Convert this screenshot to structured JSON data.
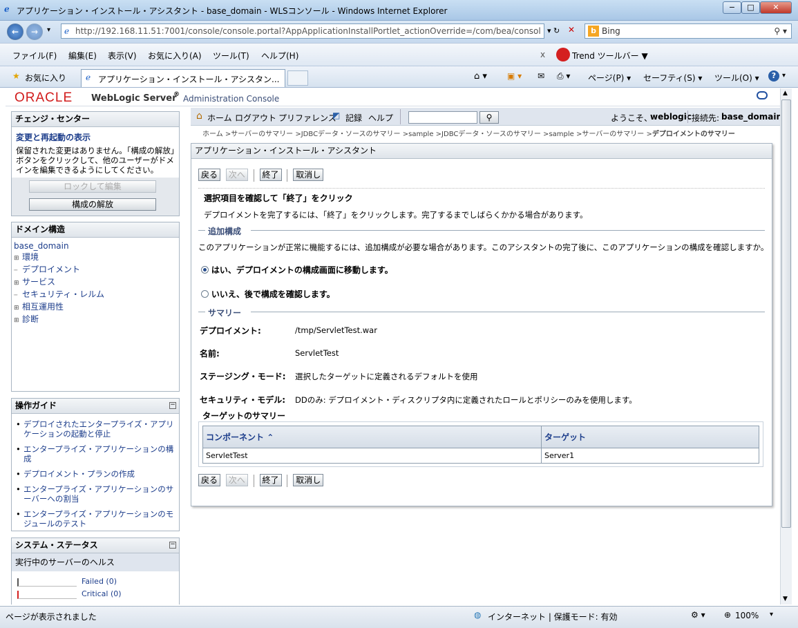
{
  "window": {
    "title": "アプリケーション・インストール・アシスタント - base_domain - WLSコンソール - Windows Internet Explorer",
    "minimize": "−",
    "maximize": "□",
    "close": "✕"
  },
  "browser": {
    "address_host": "http://192.168.11.51",
    "address_rest": ":7001/console/console.portal?AppApplicationInstallPortlet_actionOverride=/com/bea/consol",
    "search_engine": "Bing",
    "menu": [
      "ファイル(F)",
      "編集(E)",
      "表示(V)",
      "お気に入り(A)",
      "ツール(T)",
      "ヘルプ(H)"
    ],
    "trend_toolbar": "Trend ツールバー ▼",
    "favorites": "お気に入り",
    "tab_title": "アプリケーション・インストール・アシスタン...",
    "cmd_page": "ページ(P) ▾",
    "cmd_safety": "セーフティ(S) ▾",
    "cmd_tools": "ツール(O) ▾",
    "status_text": "ページが表示されました",
    "zone": "インターネット | 保護モード: 有効",
    "zoom": "100%"
  },
  "header": {
    "oracle": "ORACLE",
    "product": "WebLogic Server",
    "reg": "®",
    "console": "Administration Console"
  },
  "toolbar": {
    "home": "ホーム",
    "logout": "ログアウト",
    "preferences": "プリファレンス",
    "record": "記録",
    "help": "ヘルプ",
    "search_value": "",
    "welcome": "ようこそ、",
    "user": "weblogic",
    "connected": "接続先:",
    "domain": "base_domain"
  },
  "breadcrumb": {
    "items": [
      "ホーム",
      "サーバーのサマリー",
      "JDBCデータ・ソースのサマリー",
      "sample",
      "JDBCデータ・ソースのサマリー",
      "sample",
      "サーバーのサマリー"
    ],
    "current": "デプロイメントのサマリー"
  },
  "change_center": {
    "title": "チェンジ・センター",
    "link": "変更と再起動の表示",
    "message": "保留された変更はありません。「構成の解放」ボタンをクリックして、他のユーザーがドメインを編集できるようにしてください。",
    "lock_button": "ロックして編集",
    "release_button": "構成の解放"
  },
  "domain_structure": {
    "title": "ドメイン構造",
    "root": "base_domain",
    "items": [
      {
        "label": "環境",
        "expand": "+"
      },
      {
        "label": "デプロイメント",
        "expand": ""
      },
      {
        "label": "サービス",
        "expand": "+"
      },
      {
        "label": "セキュリティ・レルム",
        "expand": ""
      },
      {
        "label": "相互運用性",
        "expand": "+"
      },
      {
        "label": "診断",
        "expand": "+"
      }
    ]
  },
  "how_do_i": {
    "title": "操作ガイド",
    "items": [
      "デプロイされたエンタープライズ・アプリケーションの起動と停止",
      "エンタープライズ・アプリケーションの構成",
      "デプロイメント・プランの作成",
      "エンタープライズ・アプリケーションのサーバーへの割当",
      "エンタープライズ・アプリケーションのモジュールのテスト"
    ]
  },
  "system_status": {
    "title": "システム・ステータス",
    "subtitle": "実行中のサーバーのヘルス",
    "rows": [
      {
        "label": "Failed (0)",
        "color": "#555555",
        "value": 0
      },
      {
        "label": "Critical (0)",
        "color": "#d42020",
        "value": 0
      }
    ]
  },
  "assistant": {
    "title": "アプリケーション・インストール・アシスタント",
    "buttons": {
      "back": "戻る",
      "next": "次へ",
      "finish": "終了",
      "cancel": "取消し"
    },
    "heading": "選択項目を確認して「終了」をクリック",
    "instruction": "デプロイメントを完了するには、「終了」をクリックします。完了するまでしばらくかかる場合があります。",
    "additional_title": "追加構成",
    "additional_text": "このアプリケーションが正常に機能するには、追加構成が必要な場合があります。このアシスタントの完了後に、このアプリケーションの構成を確認しますか。",
    "option_yes": "はい、デプロイメントの構成画面に移動します。",
    "option_no": "いいえ、後で構成を確認します。",
    "summary_title": "サマリー",
    "summary": [
      {
        "label": "デプロイメント:",
        "value": "/tmp/ServletTest.war"
      },
      {
        "label": "名前:",
        "value": "ServletTest"
      },
      {
        "label": "ステージング・モード:",
        "value": "選択したターゲットに定義されるデフォルトを使用"
      },
      {
        "label": "セキュリティ・モデル:",
        "value": "DDのみ: デプロイメント・ディスクリプタ内に定義されたロールとポリシーのみを使用します。"
      }
    ],
    "target_summary_title": "ターゲットのサマリー",
    "table_headers": [
      "コンポーネント",
      "ターゲット"
    ],
    "table_rows": [
      [
        "ServletTest",
        "Server1"
      ]
    ]
  }
}
